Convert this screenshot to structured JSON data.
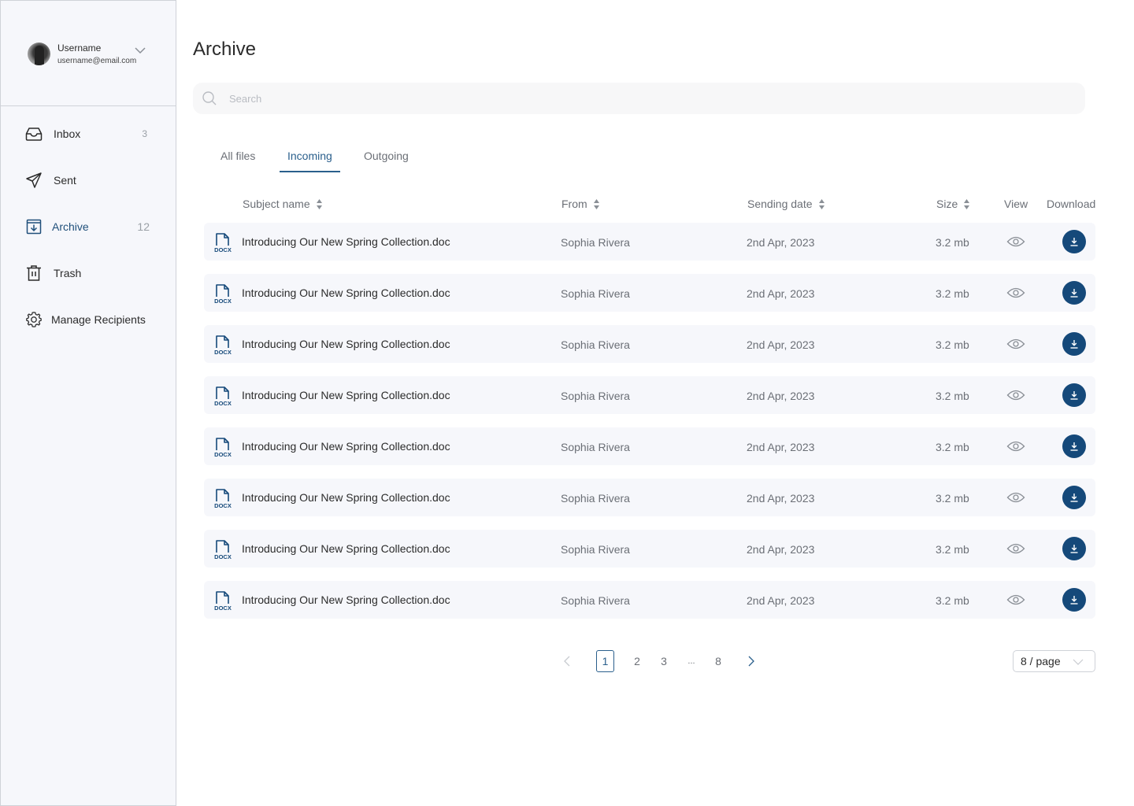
{
  "profile": {
    "username": "Username",
    "email": "username@email.com"
  },
  "sidebar": {
    "items": [
      {
        "label": "Inbox",
        "count": "3",
        "icon": "inbox-icon"
      },
      {
        "label": "Sent",
        "count": "",
        "icon": "send-icon"
      },
      {
        "label": "Archive",
        "count": "12",
        "icon": "archive-icon",
        "active": true
      },
      {
        "label": "Trash",
        "count": "",
        "icon": "trash-icon"
      },
      {
        "label": "Manage Recipients",
        "count": "",
        "icon": "gear-icon"
      }
    ]
  },
  "page": {
    "title": "Archive",
    "search_placeholder": "Search"
  },
  "tabs": [
    {
      "label": "All files"
    },
    {
      "label": "Incoming",
      "active": true
    },
    {
      "label": "Outgoing"
    }
  ],
  "table": {
    "columns": {
      "subject": "Subject name",
      "from": "From",
      "date": "Sending date",
      "size": "Size",
      "view": "View",
      "download": "Download"
    },
    "file_badge": "DOCX",
    "rows": [
      {
        "subject": "Introducing Our New Spring Collection.doc",
        "from": "Sophia Rivera",
        "date": "2nd Apr, 2023",
        "size": "3.2 mb"
      },
      {
        "subject": "Introducing Our New Spring Collection.doc",
        "from": "Sophia Rivera",
        "date": "2nd Apr, 2023",
        "size": "3.2 mb"
      },
      {
        "subject": "Introducing Our New Spring Collection.doc",
        "from": "Sophia Rivera",
        "date": "2nd Apr, 2023",
        "size": "3.2 mb"
      },
      {
        "subject": "Introducing Our New Spring Collection.doc",
        "from": "Sophia Rivera",
        "date": "2nd Apr, 2023",
        "size": "3.2 mb"
      },
      {
        "subject": "Introducing Our New Spring Collection.doc",
        "from": "Sophia Rivera",
        "date": "2nd Apr, 2023",
        "size": "3.2 mb"
      },
      {
        "subject": "Introducing Our New Spring Collection.doc",
        "from": "Sophia Rivera",
        "date": "2nd Apr, 2023",
        "size": "3.2 mb"
      },
      {
        "subject": "Introducing Our New Spring Collection.doc",
        "from": "Sophia Rivera",
        "date": "2nd Apr, 2023",
        "size": "3.2 mb"
      },
      {
        "subject": "Introducing Our New Spring Collection.doc",
        "from": "Sophia Rivera",
        "date": "2nd Apr, 2023",
        "size": "3.2 mb"
      }
    ]
  },
  "pagination": {
    "pages": [
      "1",
      "2",
      "3",
      "...",
      "8"
    ],
    "current": "1",
    "per_page": "8 / page"
  },
  "colors": {
    "accent": "#15497a",
    "active_text": "#2a5f8c",
    "row_bg": "#f6f7fb"
  }
}
